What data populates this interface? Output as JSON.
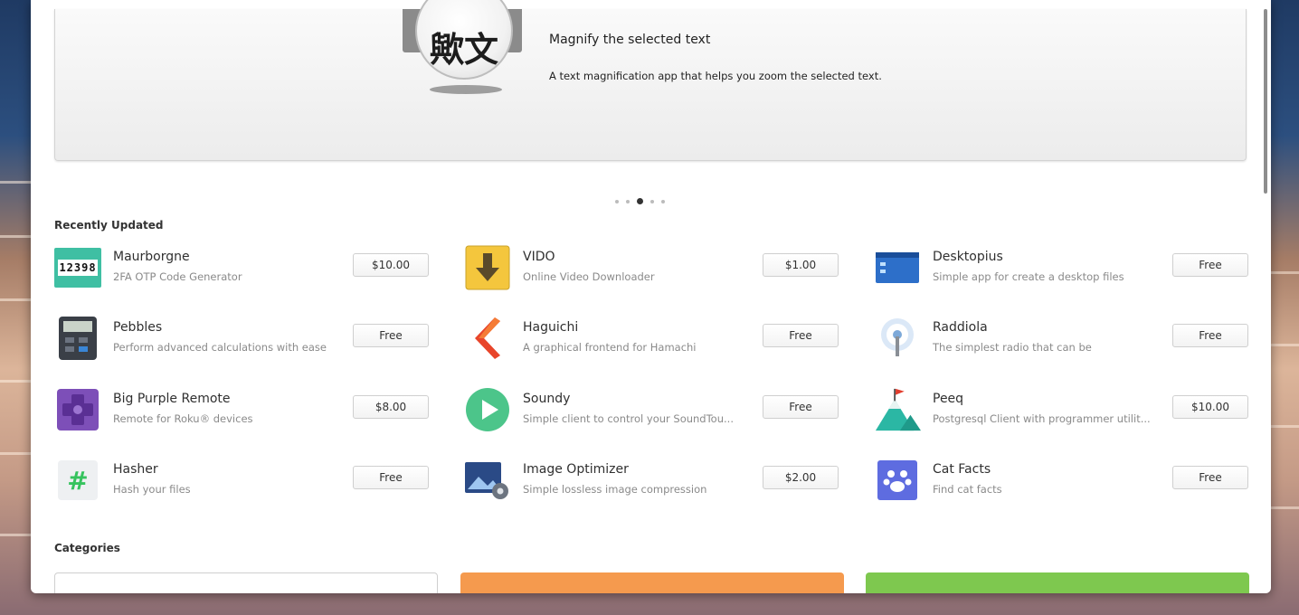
{
  "banner": {
    "glyph_left": "歟",
    "glyph_right": "文",
    "subtitle": "Magnify the selected text",
    "description": "A text magnification app that helps you zoom the selected text."
  },
  "carousel": {
    "count": 5,
    "active_index": 2
  },
  "recently_updated": {
    "title": "Recently Updated",
    "apps": [
      {
        "name": "Maurborgne",
        "summary": "2FA OTP Code Generator",
        "price": "$10.00",
        "icon": "otp-code-icon",
        "icon_text": "12398"
      },
      {
        "name": "VIDO",
        "summary": "Online Video Downloader",
        "price": "$1.00",
        "icon": "download-arrow-icon"
      },
      {
        "name": "Desktopius",
        "summary": "Simple app for create a desktop files",
        "price": "Free",
        "icon": "desktop-file-icon"
      },
      {
        "name": "Pebbles",
        "summary": "Perform advanced calculations with ease",
        "price": "Free",
        "icon": "calculator-icon"
      },
      {
        "name": "Haguichi",
        "summary": "A graphical frontend for Hamachi",
        "price": "Free",
        "icon": "chevron-logo-icon"
      },
      {
        "name": "Raddiola",
        "summary": "The simplest radio that can be",
        "price": "Free",
        "icon": "radio-antenna-icon"
      },
      {
        "name": "Big Purple Remote",
        "summary": "Remote for Roku® devices",
        "price": "$8.00",
        "icon": "dpad-remote-icon"
      },
      {
        "name": "Soundy",
        "summary": "Simple client to control your SoundTou...",
        "price": "Free",
        "icon": "play-circle-icon"
      },
      {
        "name": "Peeq",
        "summary": "Postgresql Client with programmer utilit...",
        "price": "$10.00",
        "icon": "mountain-flag-icon"
      },
      {
        "name": "Hasher",
        "summary": "Hash your files",
        "price": "Free",
        "icon": "hash-icon",
        "icon_text": "#"
      },
      {
        "name": "Image Optimizer",
        "summary": "Simple lossless image compression",
        "price": "$2.00",
        "icon": "image-gear-icon"
      },
      {
        "name": "Cat Facts",
        "summary": "Find cat facts",
        "price": "Free",
        "icon": "paw-icon"
      }
    ]
  },
  "categories": {
    "title": "Categories",
    "cards": [
      {
        "color": "#ffffff"
      },
      {
        "color": "#f59a4e"
      },
      {
        "color": "#7ec84f"
      }
    ]
  }
}
